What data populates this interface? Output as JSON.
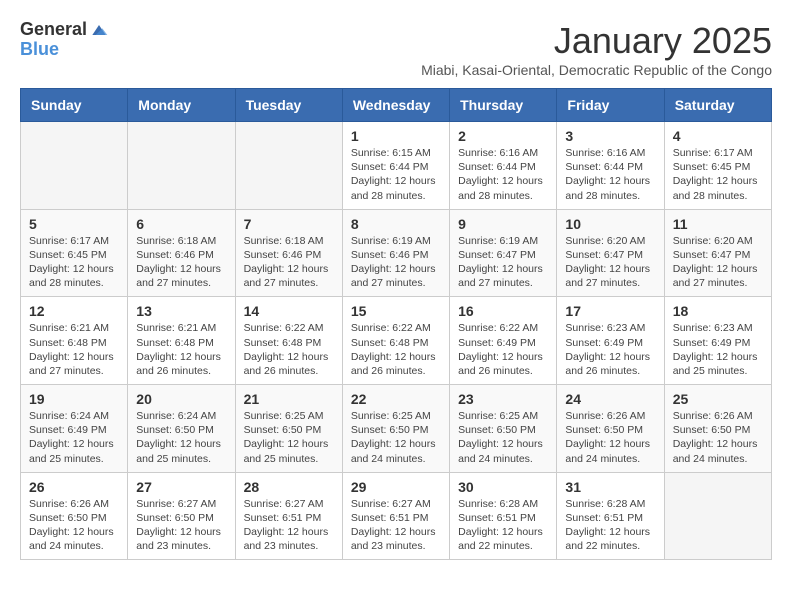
{
  "logo": {
    "general": "General",
    "blue": "Blue"
  },
  "title": "January 2025",
  "subtitle": "Miabi, Kasai-Oriental, Democratic Republic of the Congo",
  "days_of_week": [
    "Sunday",
    "Monday",
    "Tuesday",
    "Wednesday",
    "Thursday",
    "Friday",
    "Saturday"
  ],
  "weeks": [
    [
      {
        "day": "",
        "info": ""
      },
      {
        "day": "",
        "info": ""
      },
      {
        "day": "",
        "info": ""
      },
      {
        "day": "1",
        "info": "Sunrise: 6:15 AM\nSunset: 6:44 PM\nDaylight: 12 hours\nand 28 minutes."
      },
      {
        "day": "2",
        "info": "Sunrise: 6:16 AM\nSunset: 6:44 PM\nDaylight: 12 hours\nand 28 minutes."
      },
      {
        "day": "3",
        "info": "Sunrise: 6:16 AM\nSunset: 6:44 PM\nDaylight: 12 hours\nand 28 minutes."
      },
      {
        "day": "4",
        "info": "Sunrise: 6:17 AM\nSunset: 6:45 PM\nDaylight: 12 hours\nand 28 minutes."
      }
    ],
    [
      {
        "day": "5",
        "info": "Sunrise: 6:17 AM\nSunset: 6:45 PM\nDaylight: 12 hours\nand 28 minutes."
      },
      {
        "day": "6",
        "info": "Sunrise: 6:18 AM\nSunset: 6:46 PM\nDaylight: 12 hours\nand 27 minutes."
      },
      {
        "day": "7",
        "info": "Sunrise: 6:18 AM\nSunset: 6:46 PM\nDaylight: 12 hours\nand 27 minutes."
      },
      {
        "day": "8",
        "info": "Sunrise: 6:19 AM\nSunset: 6:46 PM\nDaylight: 12 hours\nand 27 minutes."
      },
      {
        "day": "9",
        "info": "Sunrise: 6:19 AM\nSunset: 6:47 PM\nDaylight: 12 hours\nand 27 minutes."
      },
      {
        "day": "10",
        "info": "Sunrise: 6:20 AM\nSunset: 6:47 PM\nDaylight: 12 hours\nand 27 minutes."
      },
      {
        "day": "11",
        "info": "Sunrise: 6:20 AM\nSunset: 6:47 PM\nDaylight: 12 hours\nand 27 minutes."
      }
    ],
    [
      {
        "day": "12",
        "info": "Sunrise: 6:21 AM\nSunset: 6:48 PM\nDaylight: 12 hours\nand 27 minutes."
      },
      {
        "day": "13",
        "info": "Sunrise: 6:21 AM\nSunset: 6:48 PM\nDaylight: 12 hours\nand 26 minutes."
      },
      {
        "day": "14",
        "info": "Sunrise: 6:22 AM\nSunset: 6:48 PM\nDaylight: 12 hours\nand 26 minutes."
      },
      {
        "day": "15",
        "info": "Sunrise: 6:22 AM\nSunset: 6:48 PM\nDaylight: 12 hours\nand 26 minutes."
      },
      {
        "day": "16",
        "info": "Sunrise: 6:22 AM\nSunset: 6:49 PM\nDaylight: 12 hours\nand 26 minutes."
      },
      {
        "day": "17",
        "info": "Sunrise: 6:23 AM\nSunset: 6:49 PM\nDaylight: 12 hours\nand 26 minutes."
      },
      {
        "day": "18",
        "info": "Sunrise: 6:23 AM\nSunset: 6:49 PM\nDaylight: 12 hours\nand 25 minutes."
      }
    ],
    [
      {
        "day": "19",
        "info": "Sunrise: 6:24 AM\nSunset: 6:49 PM\nDaylight: 12 hours\nand 25 minutes."
      },
      {
        "day": "20",
        "info": "Sunrise: 6:24 AM\nSunset: 6:50 PM\nDaylight: 12 hours\nand 25 minutes."
      },
      {
        "day": "21",
        "info": "Sunrise: 6:25 AM\nSunset: 6:50 PM\nDaylight: 12 hours\nand 25 minutes."
      },
      {
        "day": "22",
        "info": "Sunrise: 6:25 AM\nSunset: 6:50 PM\nDaylight: 12 hours\nand 24 minutes."
      },
      {
        "day": "23",
        "info": "Sunrise: 6:25 AM\nSunset: 6:50 PM\nDaylight: 12 hours\nand 24 minutes."
      },
      {
        "day": "24",
        "info": "Sunrise: 6:26 AM\nSunset: 6:50 PM\nDaylight: 12 hours\nand 24 minutes."
      },
      {
        "day": "25",
        "info": "Sunrise: 6:26 AM\nSunset: 6:50 PM\nDaylight: 12 hours\nand 24 minutes."
      }
    ],
    [
      {
        "day": "26",
        "info": "Sunrise: 6:26 AM\nSunset: 6:50 PM\nDaylight: 12 hours\nand 24 minutes."
      },
      {
        "day": "27",
        "info": "Sunrise: 6:27 AM\nSunset: 6:50 PM\nDaylight: 12 hours\nand 23 minutes."
      },
      {
        "day": "28",
        "info": "Sunrise: 6:27 AM\nSunset: 6:51 PM\nDaylight: 12 hours\nand 23 minutes."
      },
      {
        "day": "29",
        "info": "Sunrise: 6:27 AM\nSunset: 6:51 PM\nDaylight: 12 hours\nand 23 minutes."
      },
      {
        "day": "30",
        "info": "Sunrise: 6:28 AM\nSunset: 6:51 PM\nDaylight: 12 hours\nand 22 minutes."
      },
      {
        "day": "31",
        "info": "Sunrise: 6:28 AM\nSunset: 6:51 PM\nDaylight: 12 hours\nand 22 minutes."
      },
      {
        "day": "",
        "info": ""
      }
    ]
  ]
}
